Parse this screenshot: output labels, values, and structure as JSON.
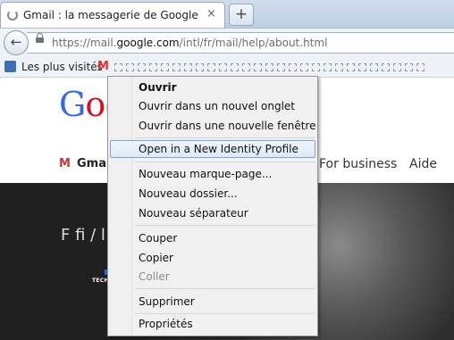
{
  "browser": {
    "tab": {
      "title": "Gmail : la messagerie de Google",
      "close": "×"
    },
    "new_tab": "+",
    "back": "←",
    "url": {
      "prefix": "https://mail.",
      "domain": "google.com",
      "path": "/intl/fr/mail/help/about.html"
    }
  },
  "bookmarks": {
    "label": "Les plus visités",
    "gmail_glyph": "M",
    "icons": [
      "most-visited-icon",
      "gmail-icon",
      "bookmark-placeholder-icon"
    ]
  },
  "page": {
    "logo": {
      "letters": [
        "G",
        "o",
        "o"
      ],
      "colors": [
        "#3369e8",
        "#d50f25",
        "#eeb211"
      ]
    },
    "nav": {
      "gmail": "Gmail",
      "business": "For business",
      "aide": "Aide"
    },
    "hero_partial": "F                         fi       /    l   f"
  },
  "context_menu": {
    "items": [
      {
        "label": "Ouvrir",
        "bold": true
      },
      {
        "label": "Ouvrir dans un nouvel onglet"
      },
      {
        "label": "Ouvrir dans une nouvelle fenêtre"
      },
      {
        "label": "Open in a New Identity Profile",
        "highlighted": true
      },
      {
        "label": "Nouveau marque-page..."
      },
      {
        "label": "Nouveau dossier..."
      },
      {
        "label": "Nouveau séparateur"
      },
      {
        "label": "Couper"
      },
      {
        "label": "Copier"
      },
      {
        "label": "Coller",
        "disabled": true
      },
      {
        "label": "Supprimer"
      },
      {
        "label": "Propriétés"
      }
    ]
  },
  "watermark": {
    "text": "TECH  TECH"
  }
}
